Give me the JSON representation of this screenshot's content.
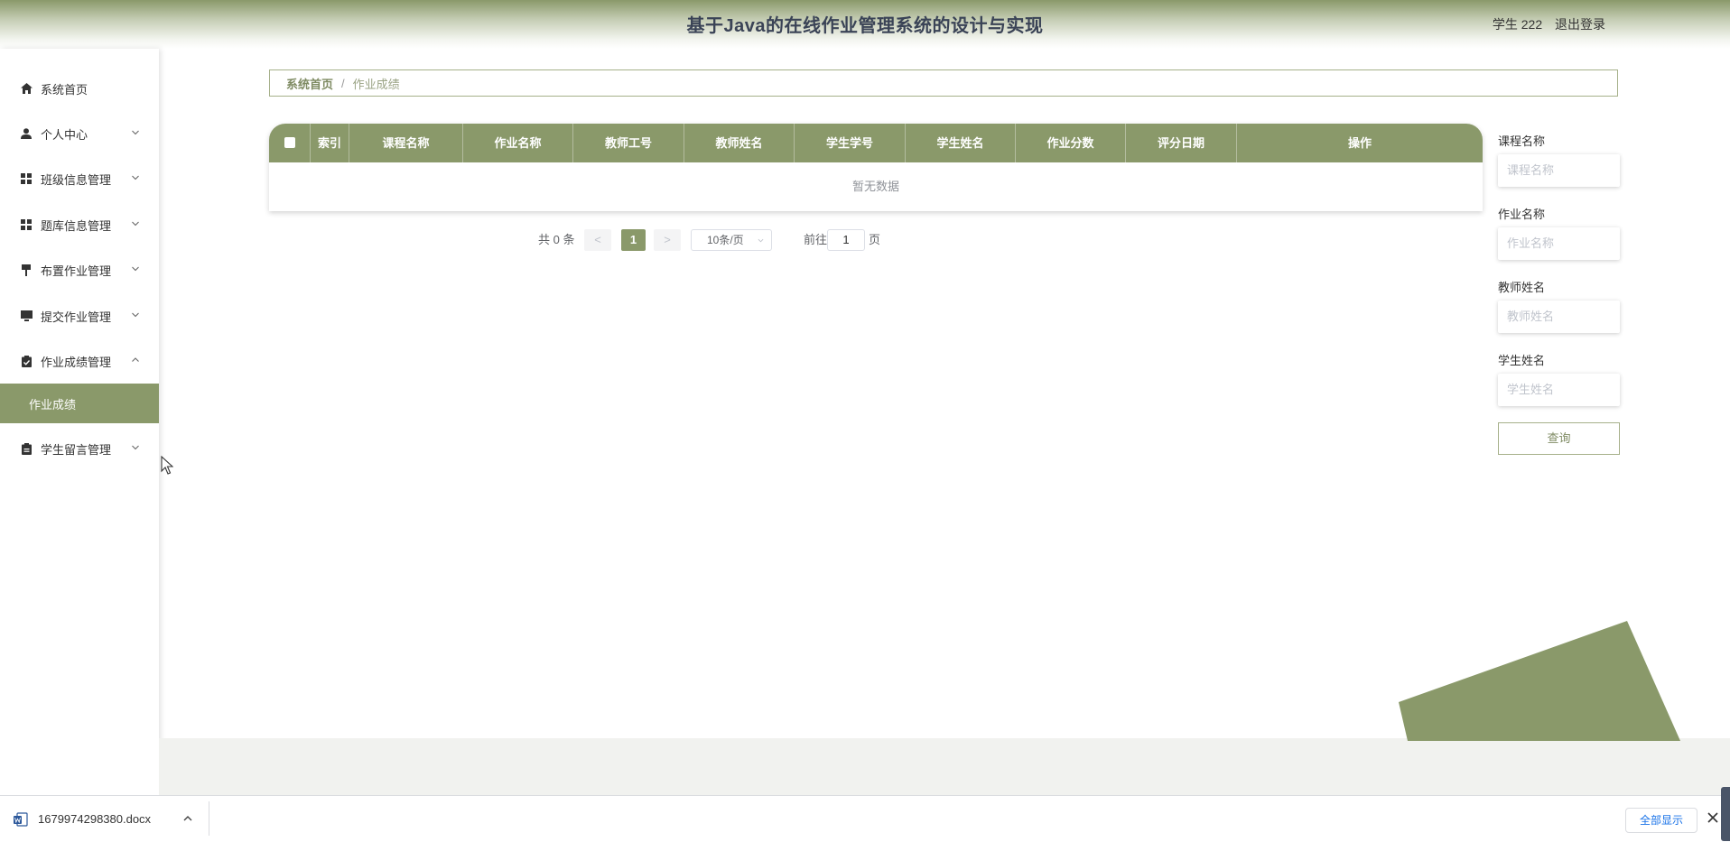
{
  "header": {
    "title": "基于Java的在线作业管理系统的设计与实现",
    "user_label": "学生 222",
    "logout": "退出登录"
  },
  "sidebar": {
    "items": [
      {
        "label": "系统首页",
        "icon": "home-icon"
      },
      {
        "label": "个人中心",
        "icon": "user-icon"
      },
      {
        "label": "班级信息管理",
        "icon": "grid-icon"
      },
      {
        "label": "题库信息管理",
        "icon": "grid-icon"
      },
      {
        "label": "布置作业管理",
        "icon": "pushpin-icon"
      },
      {
        "label": "提交作业管理",
        "icon": "monitor-icon"
      },
      {
        "label": "作业成绩管理",
        "icon": "clipboard-check-icon"
      },
      {
        "label": "学生留言管理",
        "icon": "clipboard-icon"
      }
    ],
    "active_sub": "作业成绩"
  },
  "breadcrumb": {
    "home": "系统首页",
    "separator": "/",
    "current": "作业成绩"
  },
  "table": {
    "columns": [
      "索引",
      "课程名称",
      "作业名称",
      "教师工号",
      "教师姓名",
      "学生学号",
      "学生姓名",
      "作业分数",
      "评分日期",
      "操作"
    ],
    "empty_text": "暂无数据"
  },
  "pagination": {
    "total": "共 0 条",
    "prev": "<",
    "current": "1",
    "next": ">",
    "page_size": "10条/页",
    "goto": "前往",
    "goto_value": "1",
    "page_suffix": "页"
  },
  "filters": [
    {
      "label": "课程名称",
      "placeholder": "课程名称"
    },
    {
      "label": "作业名称",
      "placeholder": "作业名称"
    },
    {
      "label": "教师姓名",
      "placeholder": "教师姓名"
    },
    {
      "label": "学生姓名",
      "placeholder": "学生姓名"
    }
  ],
  "search_button": "查询",
  "download_bar": {
    "file_name": "1679974298380.docx",
    "show_all": "全部显示"
  },
  "colors": {
    "accent": "#8a996a",
    "header_text": "#3a4356"
  }
}
